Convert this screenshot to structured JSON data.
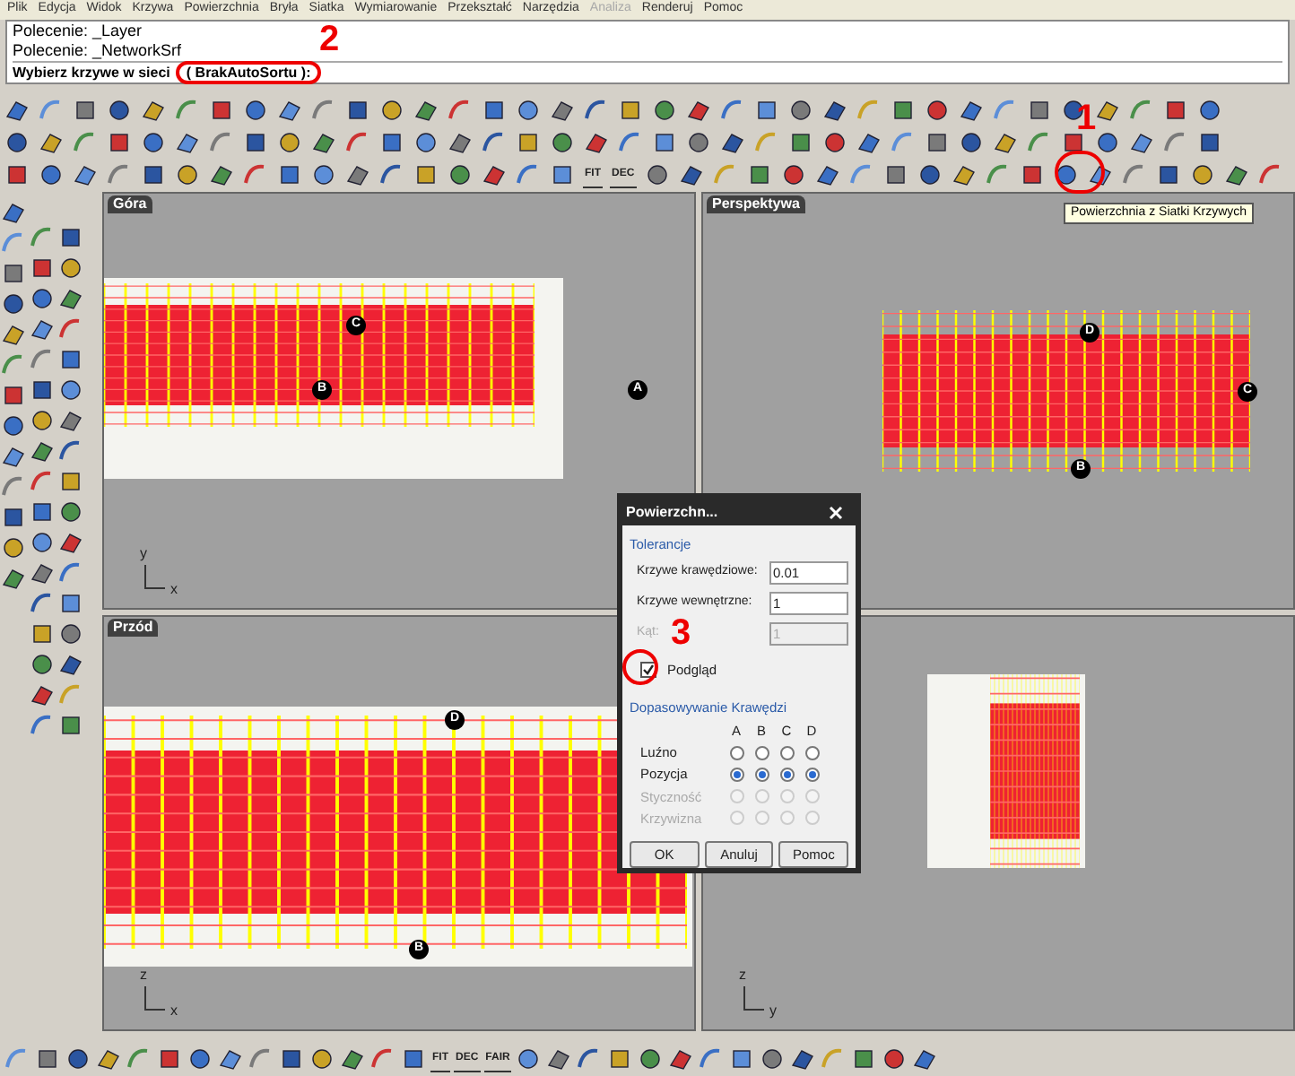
{
  "menu": [
    {
      "label": "Plik",
      "disabled": false
    },
    {
      "label": "Edycja",
      "disabled": false
    },
    {
      "label": "Widok",
      "disabled": false
    },
    {
      "label": "Krzywa",
      "disabled": false
    },
    {
      "label": "Powierzchnia",
      "disabled": false
    },
    {
      "label": "Bryła",
      "disabled": false
    },
    {
      "label": "Siatka",
      "disabled": false
    },
    {
      "label": "Wymiarowanie",
      "disabled": false
    },
    {
      "label": "Przekształć",
      "disabled": false
    },
    {
      "label": "Narzędzia",
      "disabled": false
    },
    {
      "label": "Analiza",
      "disabled": true
    },
    {
      "label": "Renderuj",
      "disabled": false
    },
    {
      "label": "Pomoc",
      "disabled": false
    }
  ],
  "command_history": [
    "Polecenie: _Layer",
    "Polecenie: _NetworkSrf"
  ],
  "command_prompt": "Wybierz krzywe w sieci",
  "command_option": "( BrakAutoSortu ):",
  "annotations": [
    "1",
    "2",
    "3"
  ],
  "toolbar_labels": [
    "FIT",
    "DEC"
  ],
  "tooltip": "Powierzchnia z Siatki Krzywych",
  "viewports": [
    {
      "title": "Góra",
      "points": [
        "C",
        "B",
        "A"
      ],
      "axes": [
        "y",
        "x"
      ]
    },
    {
      "title": "Perspektywa",
      "points": [
        "D",
        "C",
        "B"
      ]
    },
    {
      "title": "Przód",
      "points": [
        "D",
        "B"
      ],
      "axes": [
        "z",
        "x"
      ]
    },
    {
      "axes": [
        "z",
        "y"
      ]
    }
  ],
  "dialog": {
    "title": "Powierzchn...",
    "tolerance_title": "Tolerancje",
    "fields": [
      {
        "label": "Krzywe krawędziowe:",
        "value": "0.01",
        "disabled": false
      },
      {
        "label": "Krzywe wewnętrzne:",
        "value": "1",
        "disabled": false
      },
      {
        "label": "Kąt:",
        "value": "1",
        "disabled": true
      }
    ],
    "preview": {
      "label": "Podgląd",
      "checked": true
    },
    "edge_title": "Dopasowywanie Krawędzi",
    "columns": [
      "A",
      "B",
      "C",
      "D"
    ],
    "rows": [
      {
        "label": "Luźno",
        "disabled": false,
        "options": [
          {
            "selected": false
          },
          {
            "selected": false
          },
          {
            "selected": false
          },
          {
            "selected": false
          }
        ]
      },
      {
        "label": "Pozycja",
        "disabled": false,
        "options": [
          {
            "selected": true
          },
          {
            "selected": true
          },
          {
            "selected": true
          },
          {
            "selected": true
          }
        ]
      },
      {
        "label": "Styczność",
        "disabled": true,
        "options": [
          {
            "selected": false
          },
          {
            "selected": false
          },
          {
            "selected": false
          },
          {
            "selected": false
          }
        ]
      },
      {
        "label": "Krzywizna",
        "disabled": true,
        "options": [
          {
            "selected": false
          },
          {
            "selected": false
          },
          {
            "selected": false
          },
          {
            "selected": false
          }
        ]
      }
    ],
    "buttons": [
      "OK",
      "Anuluj",
      "Pomoc"
    ]
  },
  "bottom_toolbar_labels": [
    "FIT",
    "DEC",
    "FAIR"
  ]
}
